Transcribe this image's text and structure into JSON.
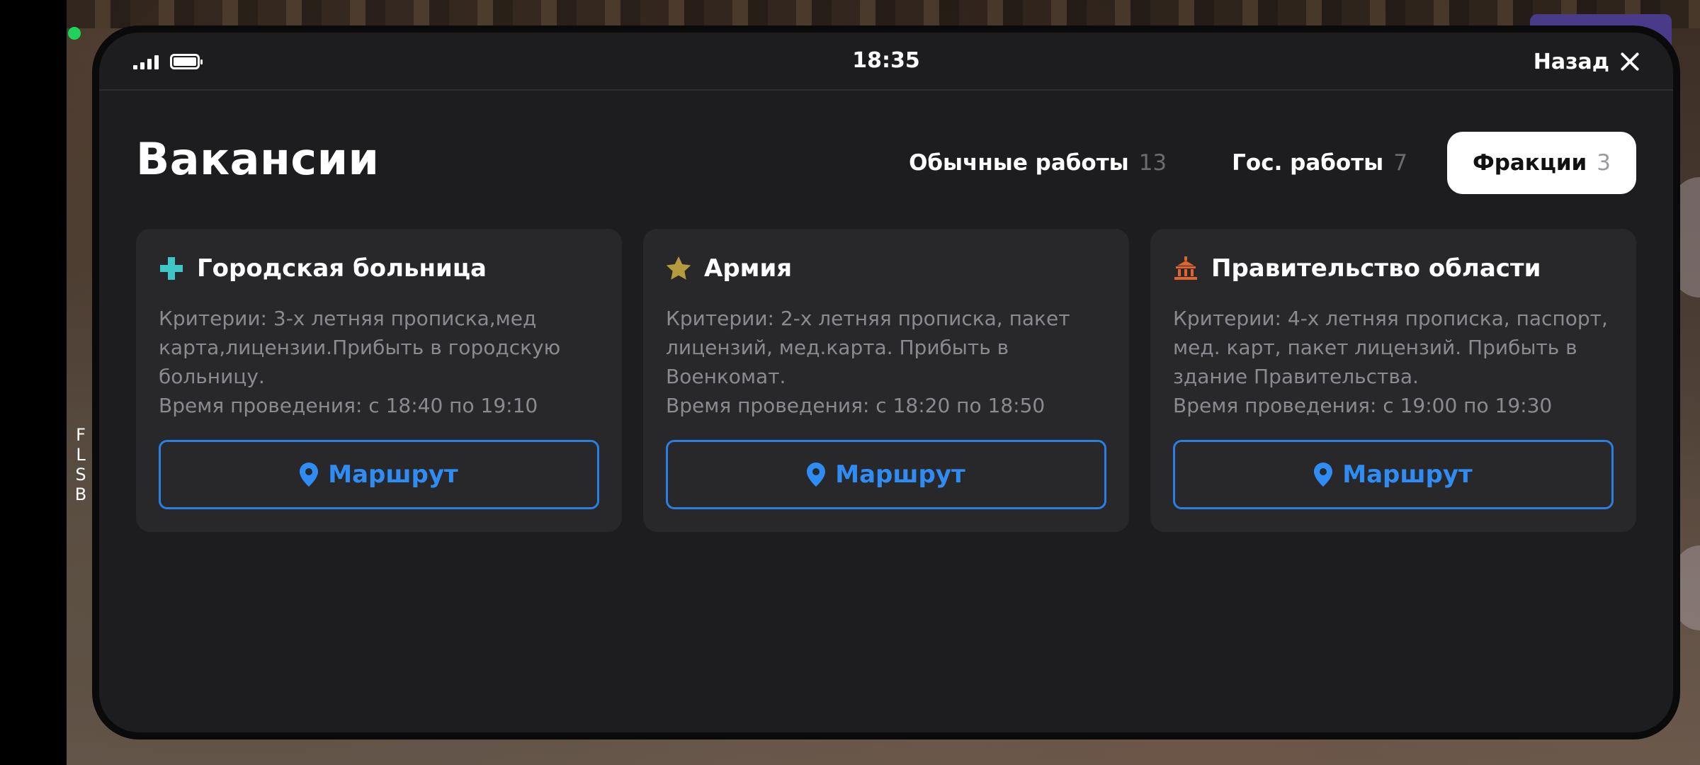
{
  "statusbar": {
    "time": "18:35",
    "back_label": "Назад"
  },
  "page": {
    "title": "Вакансии"
  },
  "side_letters": [
    "F",
    "L",
    "S",
    "B"
  ],
  "tabs": [
    {
      "label": "Обычные работы",
      "count": "13",
      "active": false
    },
    {
      "label": "Гос. работы",
      "count": "7",
      "active": false
    },
    {
      "label": "Фракции",
      "count": "3",
      "active": true
    }
  ],
  "cards": [
    {
      "title": "Городская больница",
      "icon": "medical-cross-icon",
      "icon_color": "#3ec7c7",
      "criteria": "Критерии: 3-х летняя прописка,мед карта,лицензии.Прибыть в городскую больницу.",
      "time": "Время проведения: с 18:40 по 19:10",
      "button": "Маршрут"
    },
    {
      "title": "Армия",
      "icon": "star-icon",
      "icon_color": "#b59a3e",
      "criteria": "Критерии: 2-х летняя прописка, пакет лицензий, мед.карта. Прибыть в Военкомат.",
      "time": "Время проведения: с 18:20 по 18:50",
      "button": "Маршрут"
    },
    {
      "title": "Правительство области",
      "icon": "government-building-icon",
      "icon_color": "#e0652a",
      "criteria": "Критерии: 4-х летняя прописка, паспорт, мед. карт, пакет лицензий. Прибыть в здание Правительства.",
      "time": "Время проведения: с 19:00 по 19:30",
      "button": "Маршрут"
    }
  ],
  "colors": {
    "panel_bg": "#1d1d1f",
    "card_bg": "#28282b",
    "accent_blue": "#2f8cf5",
    "online_dot": "#1fd35a"
  }
}
